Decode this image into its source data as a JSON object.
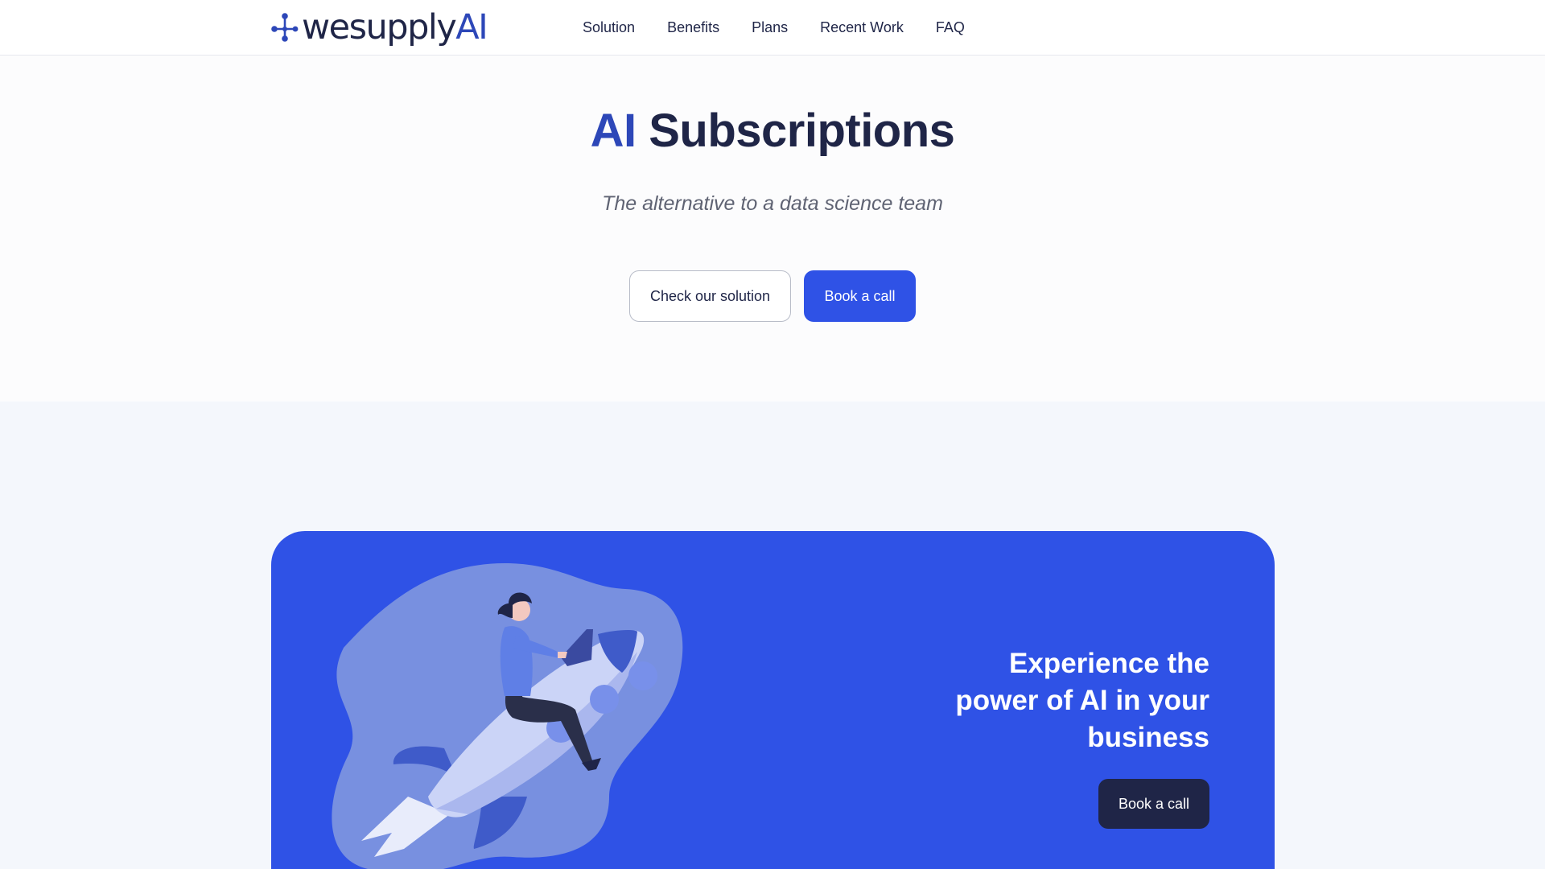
{
  "header": {
    "logo": {
      "prefix": "wesupply",
      "suffix": "AI",
      "icon": "network-nodes-icon"
    },
    "nav": [
      {
        "label": "Solution"
      },
      {
        "label": "Benefits"
      },
      {
        "label": "Plans"
      },
      {
        "label": "Recent Work"
      },
      {
        "label": "FAQ"
      }
    ]
  },
  "hero": {
    "title_accent": "AI",
    "title_rest": "Subscriptions",
    "subtitle": "The alternative to a data science team",
    "secondary_button": "Check our solution",
    "primary_button": "Book a call"
  },
  "cta": {
    "heading": "Experience the power of AI in your business",
    "button": "Book a call",
    "illustration": "person-riding-rocket-with-laptop"
  },
  "colors": {
    "brand_navy": "#1f2547",
    "brand_blue": "#2d47b8",
    "primary_button": "#2f52e6",
    "cta_background": "#2f52e6",
    "section_background": "#f4f7fc"
  }
}
